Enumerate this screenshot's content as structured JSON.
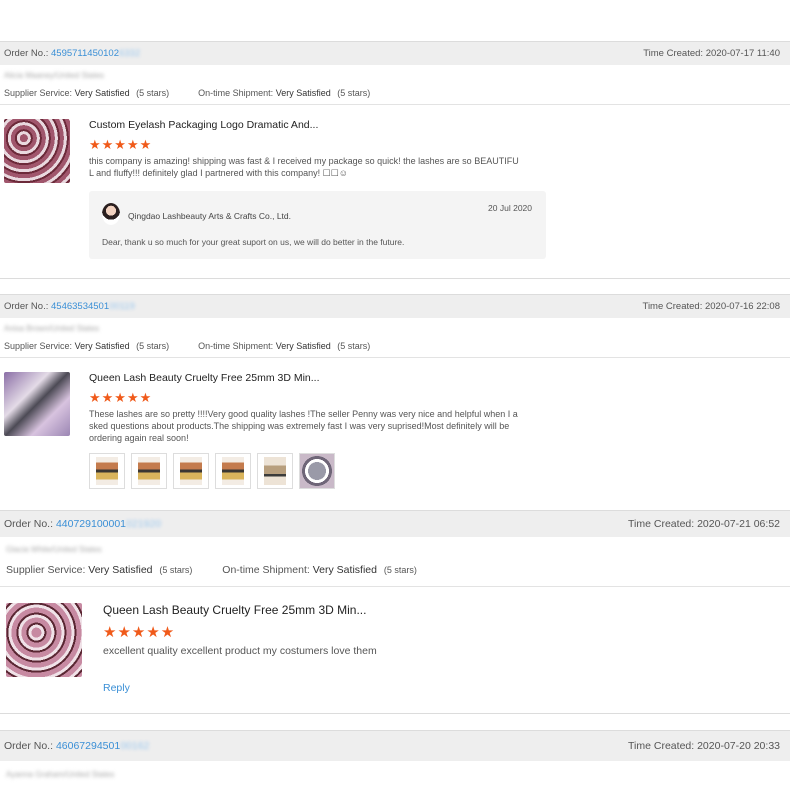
{
  "orders": [
    {
      "order_label": "Order No.:",
      "order_number": "4595711450102",
      "order_number_masked": "6332",
      "time_label": "Time Created:",
      "time_value": "2020-07-17 11:40",
      "buyer_blurred": "Alicia Maaney/United States",
      "supplier_label": "Supplier Service:",
      "supplier_value": "Very Satisfied",
      "supplier_stars": "(5 stars)",
      "shipment_label": "On-time Shipment:",
      "shipment_value": "Very Satisfied",
      "shipment_stars": "(5 stars)",
      "product_title": "Custom Eyelash Packaging Logo Dramatic And...",
      "stars": "★★★★★",
      "review_text": "this company is amazing! shipping was fast & I received my package so quick! the lashes are so BEAUTIFU L and fluffy!!! definitely glad I partnered with this company! ☐☐☺",
      "reply": {
        "seller": "Qingdao Lashbeauty Arts & Crafts Co., Ltd.",
        "date": "20 Jul 2020",
        "text": "Dear, thank u so much for your great suport on us, we will do better in the future."
      }
    },
    {
      "order_label": "Order No.:",
      "order_number": "45463534501",
      "order_number_masked": "00119",
      "time_label": "Time Created:",
      "time_value": "2020-07-16 22:08",
      "buyer_blurred": "Anisa Brown/United States",
      "supplier_label": "Supplier Service:",
      "supplier_value": "Very Satisfied",
      "supplier_stars": "(5 stars)",
      "shipment_label": "On-time Shipment:",
      "shipment_value": "Very Satisfied",
      "shipment_stars": "(5 stars)",
      "product_title": "Queen Lash Beauty Cruelty Free 25mm 3D Min...",
      "stars": "★★★★★",
      "review_text": "These lashes are so pretty !!!!Very good quality lashes !The seller Penny was very nice and helpful when I a sked questions about products.The shipping was extremely fast I was very suprised!Most definitely will be ordering again real soon!"
    },
    {
      "order_label": "Order No.:",
      "order_number": "440729100001",
      "order_number_masked": "021920",
      "time_label": "Time Created:",
      "time_value": "2020-07-21 06:52",
      "buyer_blurred": "Glacia White/United States",
      "supplier_label": "Supplier Service:",
      "supplier_value": "Very Satisfied",
      "supplier_stars": "(5 stars)",
      "shipment_label": "On-time Shipment:",
      "shipment_value": "Very Satisfied",
      "shipment_stars": "(5 stars)",
      "product_title": "Queen Lash Beauty Cruelty Free 25mm 3D Min...",
      "stars": "★★★★★",
      "review_text": "excellent quality excellent product my costumers love them",
      "reply_link": "Reply"
    },
    {
      "order_label": "Order No.:",
      "order_number": "46067294501",
      "order_number_masked": "00162",
      "time_label": "Time Created:",
      "time_value": "2020-07-20 20:33",
      "buyer_blurred": "Ayanna Graham/United States"
    }
  ]
}
